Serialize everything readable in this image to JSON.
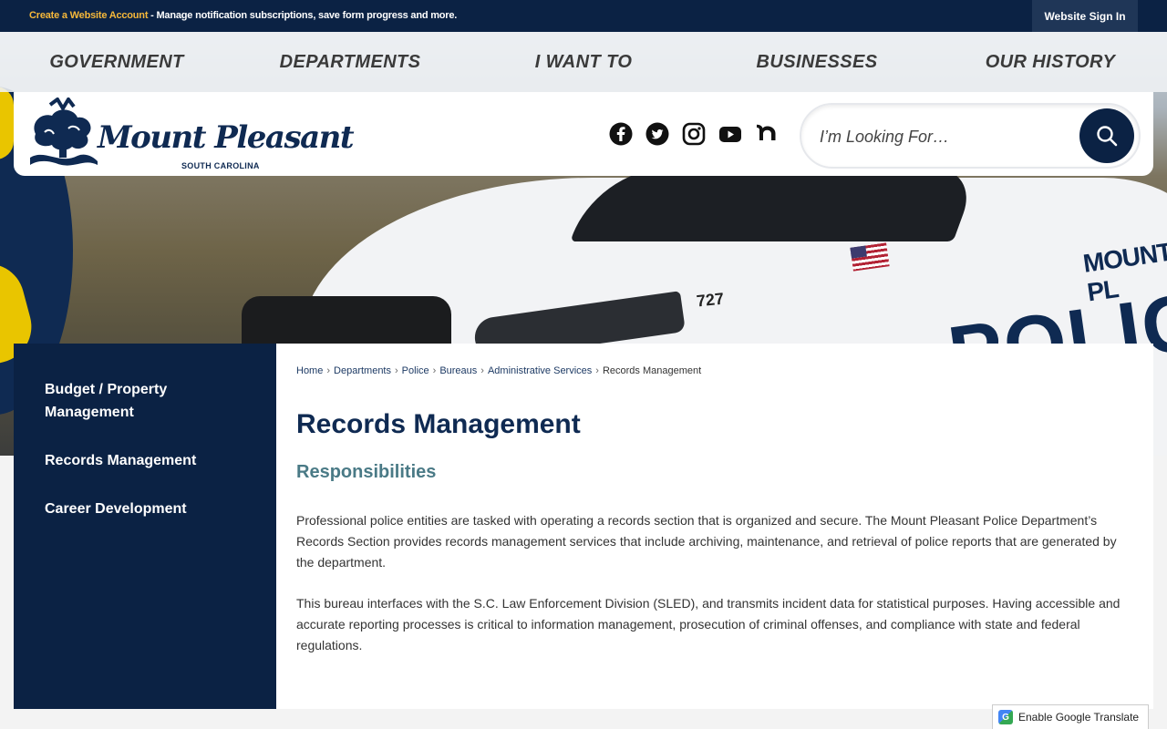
{
  "topbar": {
    "promo_link": "Create a Website Account",
    "promo_text": " - Manage notification subscriptions, save form progress and more.",
    "signin_label": "Website Sign In"
  },
  "nav": {
    "items": [
      "GOVERNMENT",
      "DEPARTMENTS",
      "I WANT TO",
      "BUSINESSES",
      "OUR HISTORY"
    ]
  },
  "logo": {
    "name": "Mount Pleasant",
    "subtitle": "SOUTH CAROLINA"
  },
  "hero": {
    "unit_number": "727",
    "door_text": "MOUNT PL",
    "door_big": "POLIC"
  },
  "social": [
    "facebook-icon",
    "twitter-icon",
    "instagram-icon",
    "youtube-icon",
    "nextdoor-icon"
  ],
  "search": {
    "placeholder": "I’m Looking For…"
  },
  "sidebar": {
    "items": [
      {
        "label": "Budget / Property Management"
      },
      {
        "label": "Records Management"
      },
      {
        "label": "Career Development"
      }
    ]
  },
  "breadcrumb": {
    "items": [
      "Home",
      "Departments",
      "Police",
      "Bureaus",
      "Administrative Services"
    ],
    "current": "Records Management"
  },
  "main": {
    "title": "Records Management",
    "section_title": "Responsibilities",
    "paragraphs": [
      "Professional police entities are tasked with operating a records section that is organized and secure. The Mount Pleasant Police Department’s Records Section provides records management services that include archiving, maintenance, and retrieval of police reports that are generated by the department.",
      "This bureau interfaces with the S.C. Law Enforcement Division (SLED), and transmits incident data for statistical purposes. Having accessible and accurate reporting processes is critical to information management, prosecution of criminal offenses, and compliance with state and federal regulations."
    ]
  },
  "translate": {
    "label": "Enable Google Translate",
    "logo_letter": "G"
  },
  "colors": {
    "navy": "#0b2244",
    "accent_gold": "#f6b83a",
    "section_teal": "#4a7a86"
  }
}
